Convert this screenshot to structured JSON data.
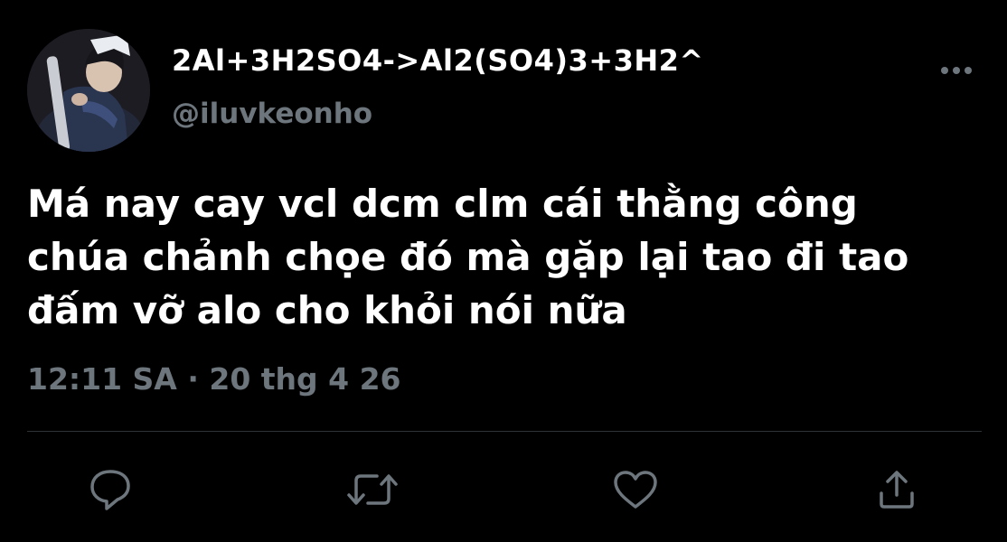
{
  "tweet": {
    "display_name": "2Al+3H2SO4->Al2(SO4)3+3H2^",
    "handle": "@iluvkeonho",
    "text_lines": [
      "Má nay cay vcl dcm clm cái thằng công",
      "chúa chảnh chọe đó mà gặp lại tao đi tao",
      "đấm vỡ alo cho khỏi nói nữa"
    ],
    "timestamp": "12:11 SA · 20 thg 4 26"
  },
  "actions": {
    "reply_icon": "reply-icon",
    "retweet_icon": "retweet-icon",
    "like_icon": "heart-icon",
    "share_icon": "share-icon",
    "more_icon": "more-dots-icon"
  },
  "colors": {
    "background": "#000000",
    "text_primary": "#ffffff",
    "text_secondary": "#6e767d",
    "divider": "#2f3336",
    "icon": "#6e767d"
  }
}
